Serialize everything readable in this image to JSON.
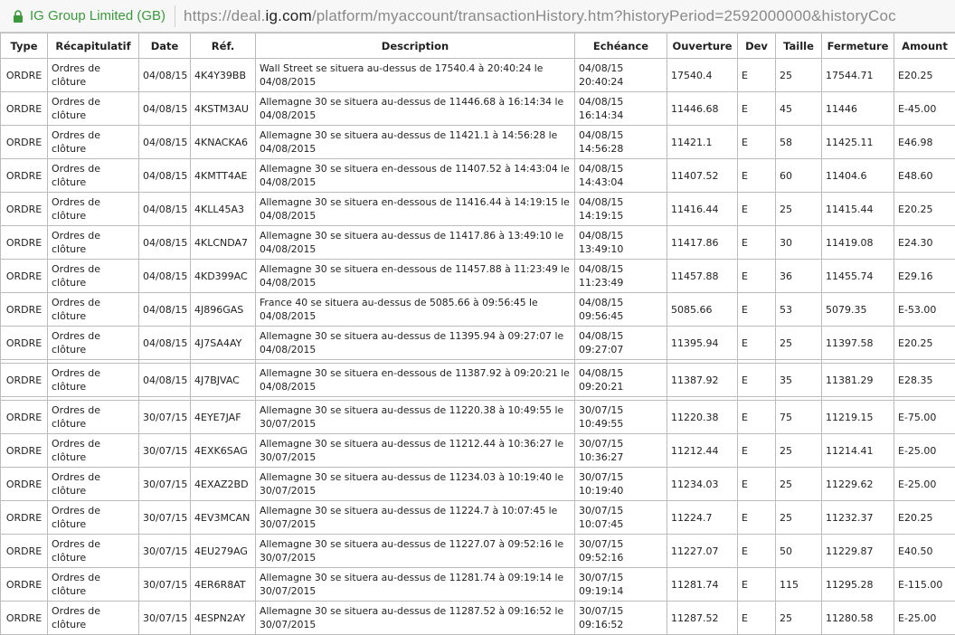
{
  "browser": {
    "site_name": "IG Group Limited (GB)",
    "url_scheme": "https://deal.",
    "url_domain": "ig.com",
    "url_path": "/platform/myaccount/transactionHistory.htm?historyPeriod=2592000000&historyCoc"
  },
  "table": {
    "columns": [
      "Type",
      "Récapitulatif",
      "Date",
      "Réf.",
      "Description",
      "Echéance",
      "Ouverture",
      "Dev",
      "Taille",
      "Fermeture",
      "Amount"
    ],
    "rows": [
      {
        "type": "ORDRE",
        "summary": "Ordres de clôture",
        "date": "04/08/15",
        "ref": "4K4Y39BB",
        "desc": "Wall Street se situera au-dessus de 17540.4 à 20:40:24 le 04/08/2015",
        "expiry": "04/08/15 20:40:24",
        "open": "17540.4",
        "cur": "E",
        "size": "25",
        "close": "17544.71",
        "amount": "E20.25"
      },
      {
        "type": "ORDRE",
        "summary": "Ordres de clôture",
        "date": "04/08/15",
        "ref": "4KSTM3AU",
        "desc": "Allemagne 30 se situera au-dessus de 11446.68 à 16:14:34 le 04/08/2015",
        "expiry": "04/08/15 16:14:34",
        "open": "11446.68",
        "cur": "E",
        "size": "45",
        "close": "11446",
        "amount": "E-45.00"
      },
      {
        "type": "ORDRE",
        "summary": "Ordres de clôture",
        "date": "04/08/15",
        "ref": "4KNACKA6",
        "desc": "Allemagne 30 se situera au-dessus de 11421.1 à 14:56:28 le 04/08/2015",
        "expiry": "04/08/15 14:56:28",
        "open": "11421.1",
        "cur": "E",
        "size": "58",
        "close": "11425.11",
        "amount": "E46.98"
      },
      {
        "type": "ORDRE",
        "summary": "Ordres de clôture",
        "date": "04/08/15",
        "ref": "4KMTT4AE",
        "desc": "Allemagne 30 se situera en-dessous de 11407.52 à 14:43:04 le 04/08/2015",
        "expiry": "04/08/15 14:43:04",
        "open": "11407.52",
        "cur": "E",
        "size": "60",
        "close": "11404.6",
        "amount": "E48.60"
      },
      {
        "type": "ORDRE",
        "summary": "Ordres de clôture",
        "date": "04/08/15",
        "ref": "4KLL45A3",
        "desc": "Allemagne 30 se situera en-dessous de 11416.44 à 14:19:15 le 04/08/2015",
        "expiry": "04/08/15 14:19:15",
        "open": "11416.44",
        "cur": "E",
        "size": "25",
        "close": "11415.44",
        "amount": "E20.25"
      },
      {
        "type": "ORDRE",
        "summary": "Ordres de clôture",
        "date": "04/08/15",
        "ref": "4KLCNDA7",
        "desc": "Allemagne 30 se situera au-dessus de 11417.86 à 13:49:10 le 04/08/2015",
        "expiry": "04/08/15 13:49:10",
        "open": "11417.86",
        "cur": "E",
        "size": "30",
        "close": "11419.08",
        "amount": "E24.30"
      },
      {
        "type": "ORDRE",
        "summary": "Ordres de clôture",
        "date": "04/08/15",
        "ref": "4KD399AC",
        "desc": "Allemagne 30 se situera en-dessous de 11457.88 à 11:23:49 le 04/08/2015",
        "expiry": "04/08/15 11:23:49",
        "open": "11457.88",
        "cur": "E",
        "size": "36",
        "close": "11455.74",
        "amount": "E29.16"
      },
      {
        "type": "ORDRE",
        "summary": "Ordres de clôture",
        "date": "04/08/15",
        "ref": "4J896GAS",
        "desc": "France 40 se situera au-dessus de 5085.66 à 09:56:45 le 04/08/2015",
        "expiry": "04/08/15 09:56:45",
        "open": "5085.66",
        "cur": "E",
        "size": "53",
        "close": "5079.35",
        "amount": "E-53.00"
      },
      {
        "type": "ORDRE",
        "summary": "Ordres de clôture",
        "date": "04/08/15",
        "ref": "4J7SA4AY",
        "desc": "Allemagne 30 se situera au-dessus de 11395.94 à 09:27:07 le 04/08/2015",
        "expiry": "04/08/15 09:27:07",
        "open": "11395.94",
        "cur": "E",
        "size": "25",
        "close": "11397.58",
        "amount": "E20.25"
      },
      {
        "gap": true
      },
      {
        "type": "ORDRE",
        "summary": "Ordres de clôture",
        "date": "04/08/15",
        "ref": "4J7BJVAC",
        "desc": "Allemagne 30 se situera en-dessous de 11387.92 à 09:20:21 le 04/08/2015",
        "expiry": "04/08/15 09:20:21",
        "open": "11387.92",
        "cur": "E",
        "size": "35",
        "close": "11381.29",
        "amount": "E28.35"
      },
      {
        "gap": true
      },
      {
        "type": "ORDRE",
        "summary": "Ordres de clôture",
        "date": "30/07/15",
        "ref": "4EYE7JAF",
        "desc": "Allemagne 30 se situera au-dessus de 11220.38 à 10:49:55 le 30/07/2015",
        "expiry": "30/07/15 10:49:55",
        "open": "11220.38",
        "cur": "E",
        "size": "75",
        "close": "11219.15",
        "amount": "E-75.00"
      },
      {
        "type": "ORDRE",
        "summary": "Ordres de clôture",
        "date": "30/07/15",
        "ref": "4EXK6SAG",
        "desc": "Allemagne 30 se situera au-dessus de 11212.44 à 10:36:27 le 30/07/2015",
        "expiry": "30/07/15 10:36:27",
        "open": "11212.44",
        "cur": "E",
        "size": "25",
        "close": "11214.41",
        "amount": "E-25.00"
      },
      {
        "type": "ORDRE",
        "summary": "Ordres de clôture",
        "date": "30/07/15",
        "ref": "4EXAZ2BD",
        "desc": "Allemagne 30 se situera au-dessus de 11234.03 à 10:19:40 le 30/07/2015",
        "expiry": "30/07/15 10:19:40",
        "open": "11234.03",
        "cur": "E",
        "size": "25",
        "close": "11229.62",
        "amount": "E-25.00"
      },
      {
        "type": "ORDRE",
        "summary": "Ordres de clôture",
        "date": "30/07/15",
        "ref": "4EV3MCAN",
        "desc": "Allemagne 30 se situera au-dessus de 11224.7 à 10:07:45 le 30/07/2015",
        "expiry": "30/07/15 10:07:45",
        "open": "11224.7",
        "cur": "E",
        "size": "25",
        "close": "11232.37",
        "amount": "E20.25"
      },
      {
        "type": "ORDRE",
        "summary": "Ordres de clôture",
        "date": "30/07/15",
        "ref": "4EU279AG",
        "desc": "Allemagne 30 se situera au-dessus de 11227.07 à 09:52:16 le 30/07/2015",
        "expiry": "30/07/15 09:52:16",
        "open": "11227.07",
        "cur": "E",
        "size": "50",
        "close": "11229.87",
        "amount": "E40.50"
      },
      {
        "type": "ORDRE",
        "summary": "Ordres de clôture",
        "date": "30/07/15",
        "ref": "4ER6R8AT",
        "desc": "Allemagne 30 se situera au-dessus de 11281.74 à 09:19:14 le 30/07/2015",
        "expiry": "30/07/15 09:19:14",
        "open": "11281.74",
        "cur": "E",
        "size": "115",
        "close": "11295.28",
        "amount": "E-115.00"
      },
      {
        "type": "ORDRE",
        "summary": "Ordres de clôture",
        "date": "30/07/15",
        "ref": "4ESPN2AY",
        "desc": "Allemagne 30 se situera au-dessus de 11287.52 à 09:16:52 le 30/07/2015",
        "expiry": "30/07/15 09:16:52",
        "open": "11287.52",
        "cur": "E",
        "size": "25",
        "close": "11280.58",
        "amount": "E-25.00"
      }
    ]
  }
}
